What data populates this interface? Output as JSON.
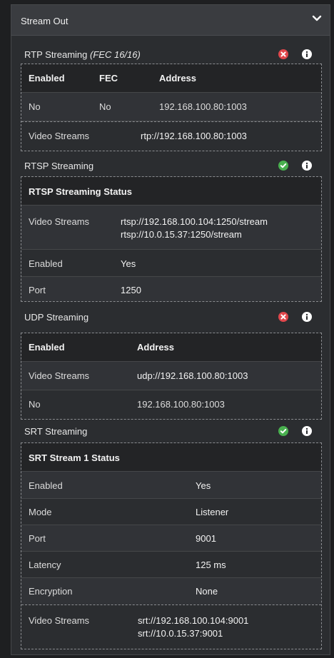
{
  "header": {
    "title": "Stream Out"
  },
  "rtp": {
    "title": "RTP Streaming",
    "title_suffix": "(FEC 16/16)",
    "status": "error",
    "table": {
      "headers": [
        "Enabled",
        "FEC",
        "Address"
      ],
      "row": [
        "No",
        "No",
        "192.168.100.80:1003"
      ],
      "video_label": "Video Streams",
      "video_value": "rtp://192.168.100.80:1003"
    }
  },
  "rtsp": {
    "title": "RTSP Streaming",
    "status": "ok",
    "box_title": "RTSP Streaming Status",
    "rows": [
      {
        "label": "Video Streams",
        "values": [
          "rtsp://192.168.100.104:1250/stream",
          "rtsp://10.0.15.37:1250/stream"
        ]
      },
      {
        "label": "Enabled",
        "values": [
          "Yes"
        ]
      },
      {
        "label": "Port",
        "values": [
          "1250"
        ]
      }
    ]
  },
  "udp": {
    "title": "UDP Streaming",
    "status": "error",
    "table": {
      "headers": [
        "Enabled",
        "Address"
      ],
      "video_label": "Video Streams",
      "video_value": "udp://192.168.100.80:1003",
      "row": [
        "No",
        "192.168.100.80:1003"
      ]
    }
  },
  "srt": {
    "title": "SRT Streaming",
    "status": "ok",
    "box_title": "SRT Stream 1 Status",
    "rows": [
      {
        "label": "Enabled",
        "value": "Yes"
      },
      {
        "label": "Mode",
        "value": "Listener"
      },
      {
        "label": "Port",
        "value": "9001"
      },
      {
        "label": "Latency",
        "value": "125 ms"
      },
      {
        "label": "Encryption",
        "value": "None"
      }
    ],
    "video_label": "Video Streams",
    "video_values": [
      "srt://192.168.100.104:9001",
      "srt://10.0.15.37:9001"
    ]
  },
  "colors": {
    "error": "#e0474c",
    "ok": "#49b04f",
    "info": "#ffffff"
  },
  "icons": {
    "collapse": "chevron-down-icon",
    "error": "error-x-icon",
    "ok": "check-circle-icon",
    "info": "info-icon"
  }
}
